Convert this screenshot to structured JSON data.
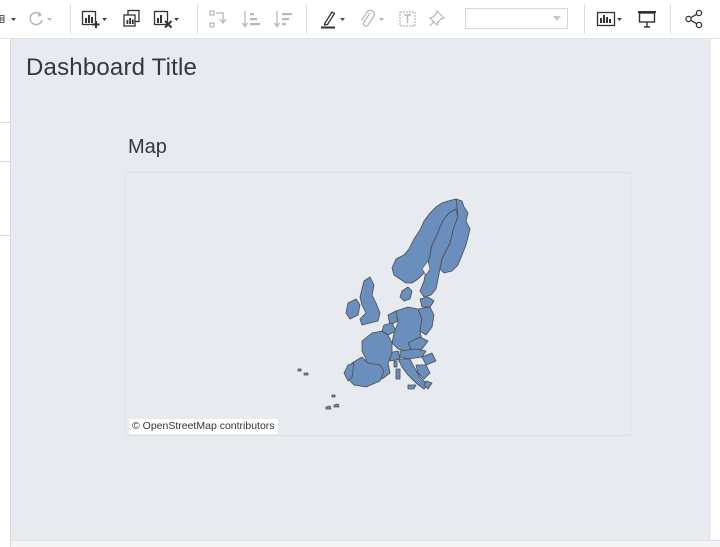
{
  "toolbar": {
    "icons": [
      "data-source-icon",
      "refresh-icon",
      "new-worksheet-icon",
      "duplicate-sheet-icon",
      "clear-sheet-icon",
      "swap-axes-icon",
      "sort-ascending-icon",
      "sort-descending-icon",
      "highlight-icon",
      "group-icon",
      "show-labels-icon",
      "pin-icon",
      "show-me-icon",
      "presentation-mode-icon",
      "share-icon"
    ],
    "fit_dropdown_value": ""
  },
  "dashboard": {
    "title": "Dashboard Title",
    "sheet": {
      "title": "Map",
      "attribution": "© OpenStreetMap contributors"
    }
  },
  "colors": {
    "canvas_background": "#e7ebf0",
    "map_fill": "#6a8fbd",
    "map_stroke": "#4a4a4a",
    "text": "#333840"
  }
}
